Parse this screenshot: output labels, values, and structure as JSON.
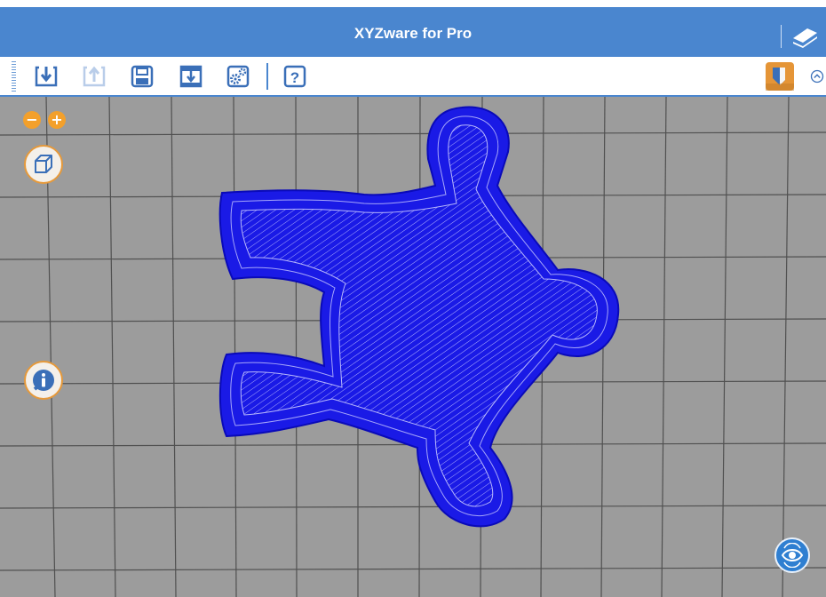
{
  "app": {
    "title": "XYZware for Pro"
  },
  "toolbar": {
    "buttons": [
      {
        "name": "import",
        "icon": "import-icon"
      },
      {
        "name": "export",
        "icon": "export-icon",
        "disabled": true
      },
      {
        "name": "save",
        "icon": "save-icon"
      },
      {
        "name": "print",
        "icon": "print-icon"
      },
      {
        "name": "settings",
        "icon": "gear-icon"
      },
      {
        "name": "help",
        "icon": "help-icon"
      }
    ]
  },
  "viewport": {
    "zoom_out_label": "−",
    "zoom_in_label": "+",
    "object_color": "#1a1ae6",
    "accent_color": "#f3a02b"
  }
}
